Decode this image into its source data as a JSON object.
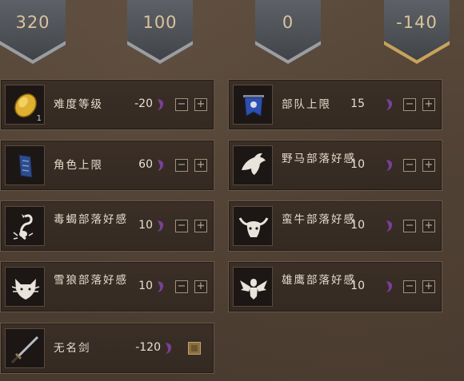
{
  "banners": [
    {
      "value": "320",
      "style": "silver"
    },
    {
      "value": "100",
      "style": "silver"
    },
    {
      "value": "0",
      "style": "silver"
    },
    {
      "value": "-140",
      "style": "gold"
    }
  ],
  "cards": [
    {
      "id": "difficulty",
      "label": "难度等级",
      "cost": "-20",
      "icon": "gold-oval-icon",
      "badge": "1",
      "controls": "stepper"
    },
    {
      "id": "troop-cap",
      "label": "部队上限",
      "cost": "15",
      "icon": "blue-banner-icon",
      "controls": "stepper"
    },
    {
      "id": "role-cap",
      "label": "角色上限",
      "cost": "60",
      "icon": "blue-book-icon",
      "controls": "stepper"
    },
    {
      "id": "wild-horse",
      "label": "野马部落好感",
      "cost": "10",
      "icon": "horse-head-icon",
      "controls": "stepper"
    },
    {
      "id": "scorpion",
      "label": "毒蝎部落好感",
      "cost": "10",
      "icon": "scorpion-icon",
      "controls": "stepper"
    },
    {
      "id": "bull",
      "label": "蛮牛部落好感",
      "cost": "10",
      "icon": "bull-head-icon",
      "controls": "stepper"
    },
    {
      "id": "snow-wolf",
      "label": "雪狼部落好感",
      "cost": "10",
      "icon": "wolf-head-icon",
      "controls": "stepper"
    },
    {
      "id": "eagle",
      "label": "雄鹰部落好感",
      "cost": "10",
      "icon": "eagle-icon",
      "controls": "stepper"
    },
    {
      "id": "nameless-sword",
      "label": "无名剑",
      "cost": "-120",
      "icon": "sword-icon",
      "controls": "checkbox"
    }
  ],
  "buttons": {
    "minus": "−",
    "plus": "+"
  },
  "colors": {
    "accent_gold": "#c9a25a",
    "panel": "#362b23",
    "currency_purple": "#7a3f9a"
  }
}
